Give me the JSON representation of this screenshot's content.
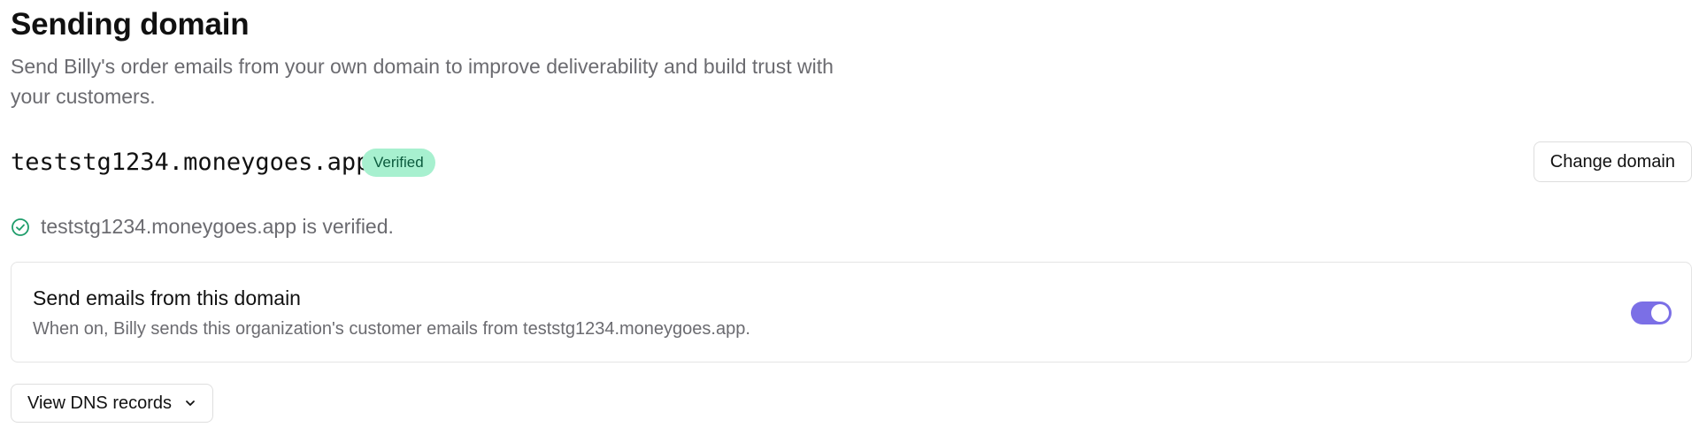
{
  "header": {
    "title": "Sending domain",
    "description": "Send Billy's order emails from your own domain to improve deliverability and build trust with your customers."
  },
  "domain": {
    "name": "teststg1234.moneygoes.app",
    "badge": "Verified",
    "change_button": "Change domain"
  },
  "status": {
    "icon": "check-circle-icon",
    "text": "teststg1234.moneygoes.app is verified."
  },
  "send_toggle": {
    "title": "Send emails from this domain",
    "subtitle": "When on, Billy sends this organization's customer emails from teststg1234.moneygoes.app.",
    "enabled": true
  },
  "dns": {
    "button_label": "View DNS records",
    "icon": "chevron-down-icon"
  },
  "colors": {
    "badge_bg": "#a7f0cf",
    "badge_text": "#0b5a3d",
    "success_icon": "#1f9d6b",
    "toggle_on": "#7b6fe6"
  }
}
